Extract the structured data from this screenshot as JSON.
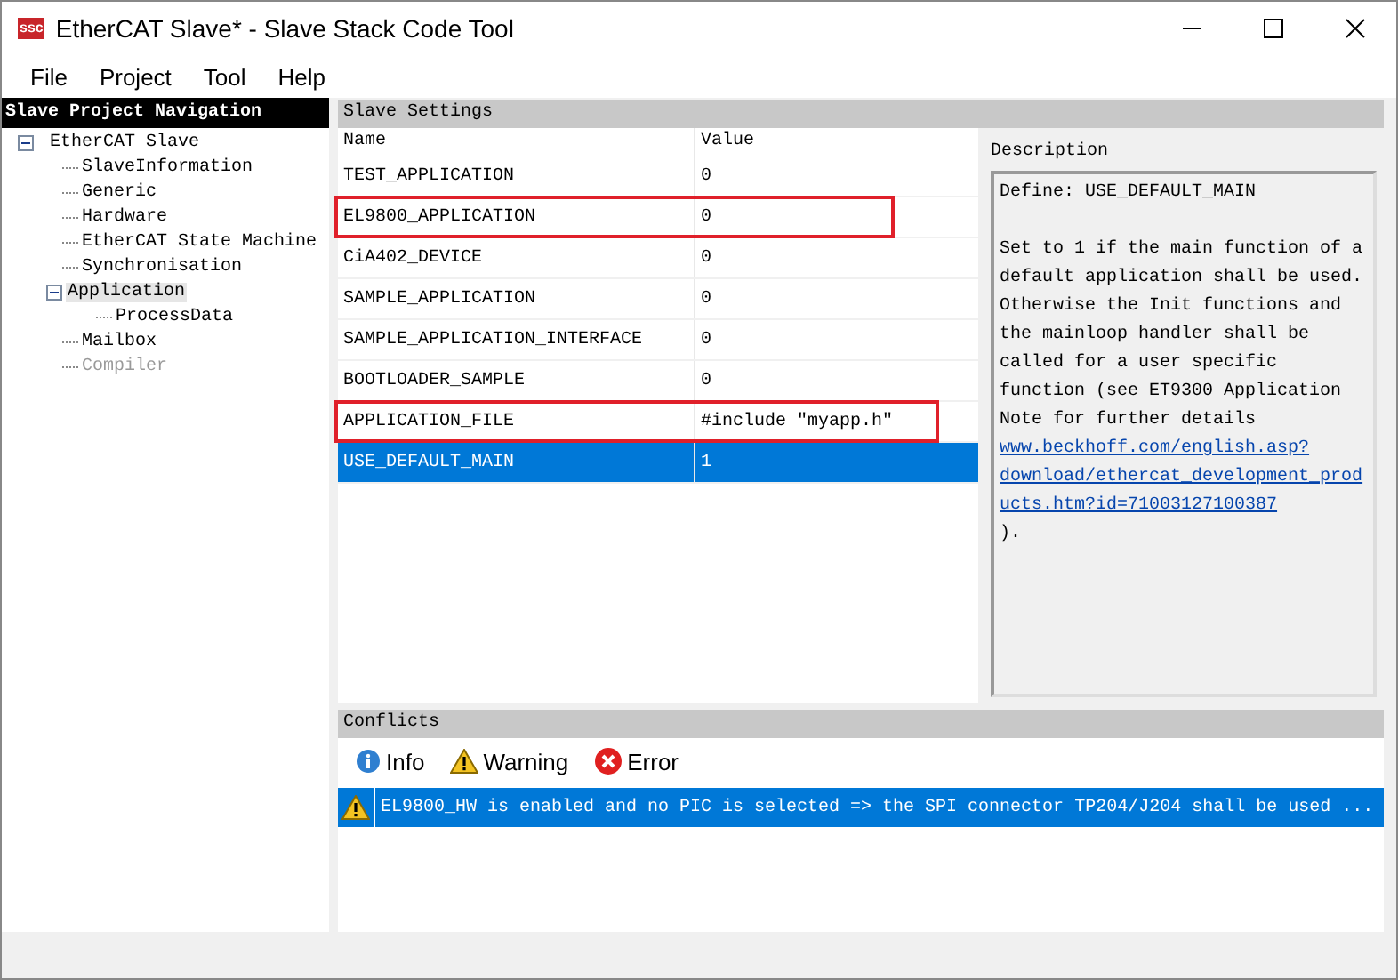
{
  "window": {
    "icon_text": "ssc",
    "title": "EtherCAT Slave* - Slave Stack Code Tool"
  },
  "menu": [
    "File",
    "Project",
    "Tool",
    "Help"
  ],
  "navigation": {
    "title": "Slave Project Navigation",
    "tree": [
      {
        "label": "EtherCAT Slave",
        "expanded": true,
        "selected": false,
        "disabled": false,
        "children": [
          {
            "label": "SlaveInformation",
            "selected": false,
            "disabled": false
          },
          {
            "label": "Generic",
            "selected": false,
            "disabled": false
          },
          {
            "label": "Hardware",
            "selected": false,
            "disabled": false
          },
          {
            "label": "EtherCAT State Machine",
            "selected": false,
            "disabled": false
          },
          {
            "label": "Synchronisation",
            "selected": false,
            "disabled": false
          },
          {
            "label": "Application",
            "expanded": true,
            "selected": true,
            "disabled": false,
            "children": [
              {
                "label": "ProcessData",
                "selected": false,
                "disabled": false
              }
            ]
          },
          {
            "label": "Mailbox",
            "selected": false,
            "disabled": false
          },
          {
            "label": "Compiler",
            "selected": false,
            "disabled": true
          }
        ]
      }
    ]
  },
  "settings": {
    "title": "Slave Settings",
    "columns": [
      "Name",
      "Value"
    ],
    "rows": [
      {
        "name": "TEST_APPLICATION",
        "value": "0",
        "selected": false,
        "highlighted": false
      },
      {
        "name": "EL9800_APPLICATION",
        "value": "0",
        "selected": false,
        "highlighted": true
      },
      {
        "name": "CiA402_DEVICE",
        "value": "0",
        "selected": false,
        "highlighted": false
      },
      {
        "name": "SAMPLE_APPLICATION",
        "value": "0",
        "selected": false,
        "highlighted": false
      },
      {
        "name": "SAMPLE_APPLICATION_INTERFACE",
        "value": "0",
        "selected": false,
        "highlighted": false
      },
      {
        "name": "BOOTLOADER_SAMPLE",
        "value": "0",
        "selected": false,
        "highlighted": false
      },
      {
        "name": "APPLICATION_FILE",
        "value": "#include \"myapp.h\"",
        "selected": false,
        "highlighted": true
      },
      {
        "name": "USE_DEFAULT_MAIN",
        "value": "1",
        "selected": true,
        "highlighted": false
      }
    ]
  },
  "description": {
    "title": "Description",
    "define": "Define: USE_DEFAULT_MAIN",
    "text": "Set to 1 if the main function of a default application shall be used. Otherwise the Init functions and the mainloop handler shall be called for a user specific function (see ET9300 Application Note for further details",
    "link": "www.beckhoff.com/english.asp?download/ethercat_development_products.htm?id=71003127100387",
    "after": ")."
  },
  "conflicts": {
    "title": "Conflicts",
    "filters": [
      {
        "kind": "info",
        "label": "Info"
      },
      {
        "kind": "warning",
        "label": "Warning"
      },
      {
        "kind": "error",
        "label": "Error"
      }
    ],
    "items": [
      {
        "kind": "warning",
        "text": "EL9800_HW is enabled and no PIC is selected => the SPI connector TP204/J204 shall be used ...",
        "selected": true
      }
    ]
  }
}
